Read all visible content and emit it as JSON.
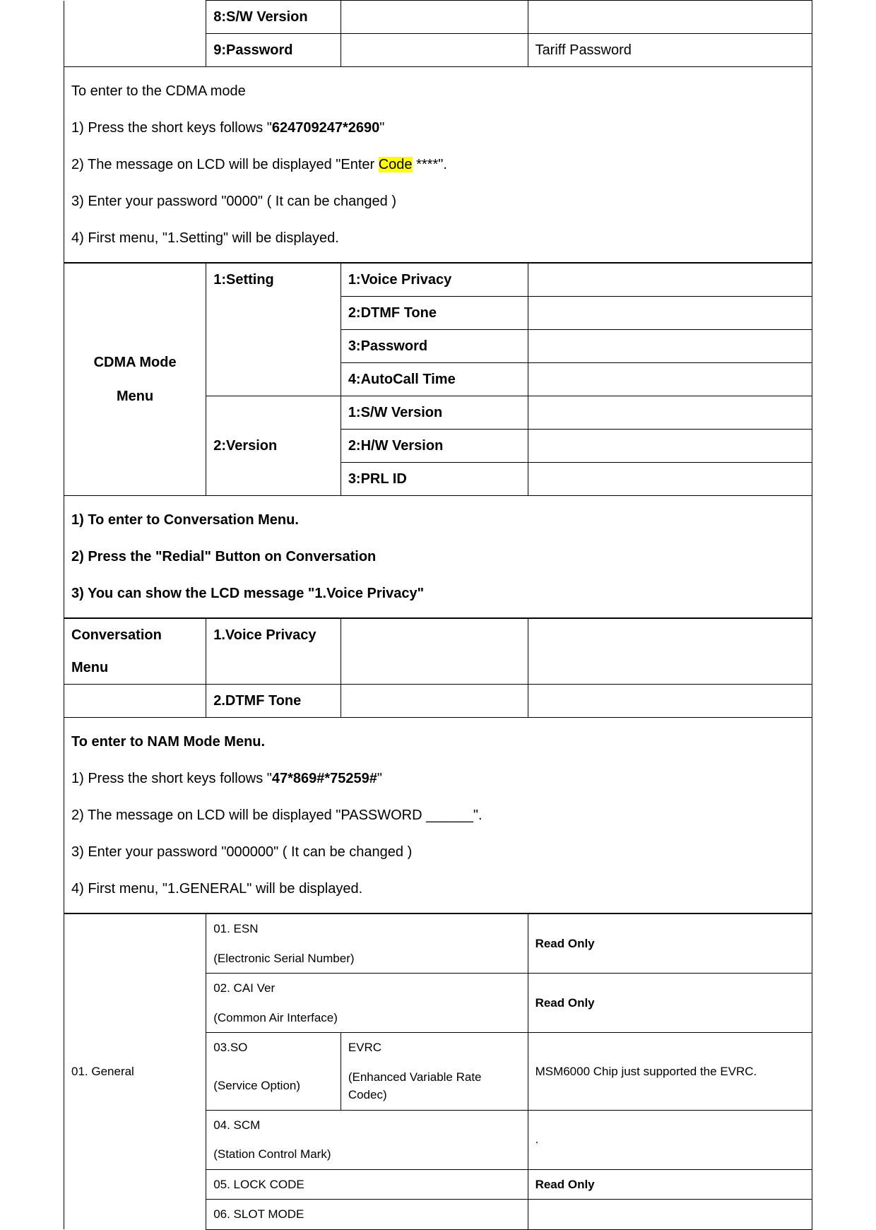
{
  "table1": {
    "row1_col2": "8:S/W Version",
    "row2_col2": "9:Password",
    "row2_col4": "Tariff Password"
  },
  "section1": {
    "header": "To enter to the CDMA mode",
    "line1_a": "1) Press the short keys follows \"",
    "line1_bold": "624709247*2690",
    "line1_c": "\"",
    "line2_a": "2) The message on LCD will be displayed \"Enter ",
    "line2_hl": "Code",
    "line2_c": " ****\".",
    "line3": "3) Enter your password \"0000\" ( It can be changed )",
    "line4": "4) First menu, \"1.Setting\" will be displayed."
  },
  "table2": {
    "col1": "CDMA Mode Menu",
    "setting": "1:Setting",
    "version": "2:Version",
    "r1": "1:Voice Privacy",
    "r2": "2:DTMF Tone",
    "r3": "3:Password",
    "r4": "4:AutoCall Time",
    "r5": "1:S/W Version",
    "r6": "2:H/W Version",
    "r7": "3:PRL ID"
  },
  "section2": {
    "line1": "1) To enter to Conversation Menu.",
    "line2": "2) Press the \"Redial\" Button on Conversation",
    "line3": "3) You can show the LCD message \"1.Voice Privacy\""
  },
  "table3": {
    "col1_a": "Conversation",
    "col1_b": "Menu",
    "r1": "1.Voice Privacy",
    "r2": "2.DTMF Tone"
  },
  "section3": {
    "header": "To enter to NAM Mode Menu.",
    "line1_a": "1) Press the short keys follows \"",
    "line1_bold": "47*869#*75259#",
    "line1_c": "\"",
    "line2": "2) The message on LCD will be displayed \"PASSWORD ______\".",
    "line3": "3) Enter your password \"000000\" ( It can be changed )",
    "line4": "4) First menu, \"1.GENERAL\" will be displayed."
  },
  "table4": {
    "col1": "01. General",
    "r1a": "01. ESN",
    "r1b": "(Electronic Serial Number)",
    "r1v": "Read Only",
    "r2a": "02. CAI Ver",
    "r2b": "(Common Air Interface)",
    "r2v": "Read Only",
    "r3a": "03.SO",
    "r3b": "(Service Option)",
    "r3c": "EVRC",
    "r3d": "(Enhanced Variable Rate Codec)",
    "r3v": "MSM6000 Chip just supported the EVRC.",
    "r4a": "04. SCM",
    "r4b": "(Station Control Mark)",
    "r4v": ".",
    "r5a": "05. LOCK CODE",
    "r5v": "Read Only",
    "r6a": "06. SLOT MODE"
  }
}
